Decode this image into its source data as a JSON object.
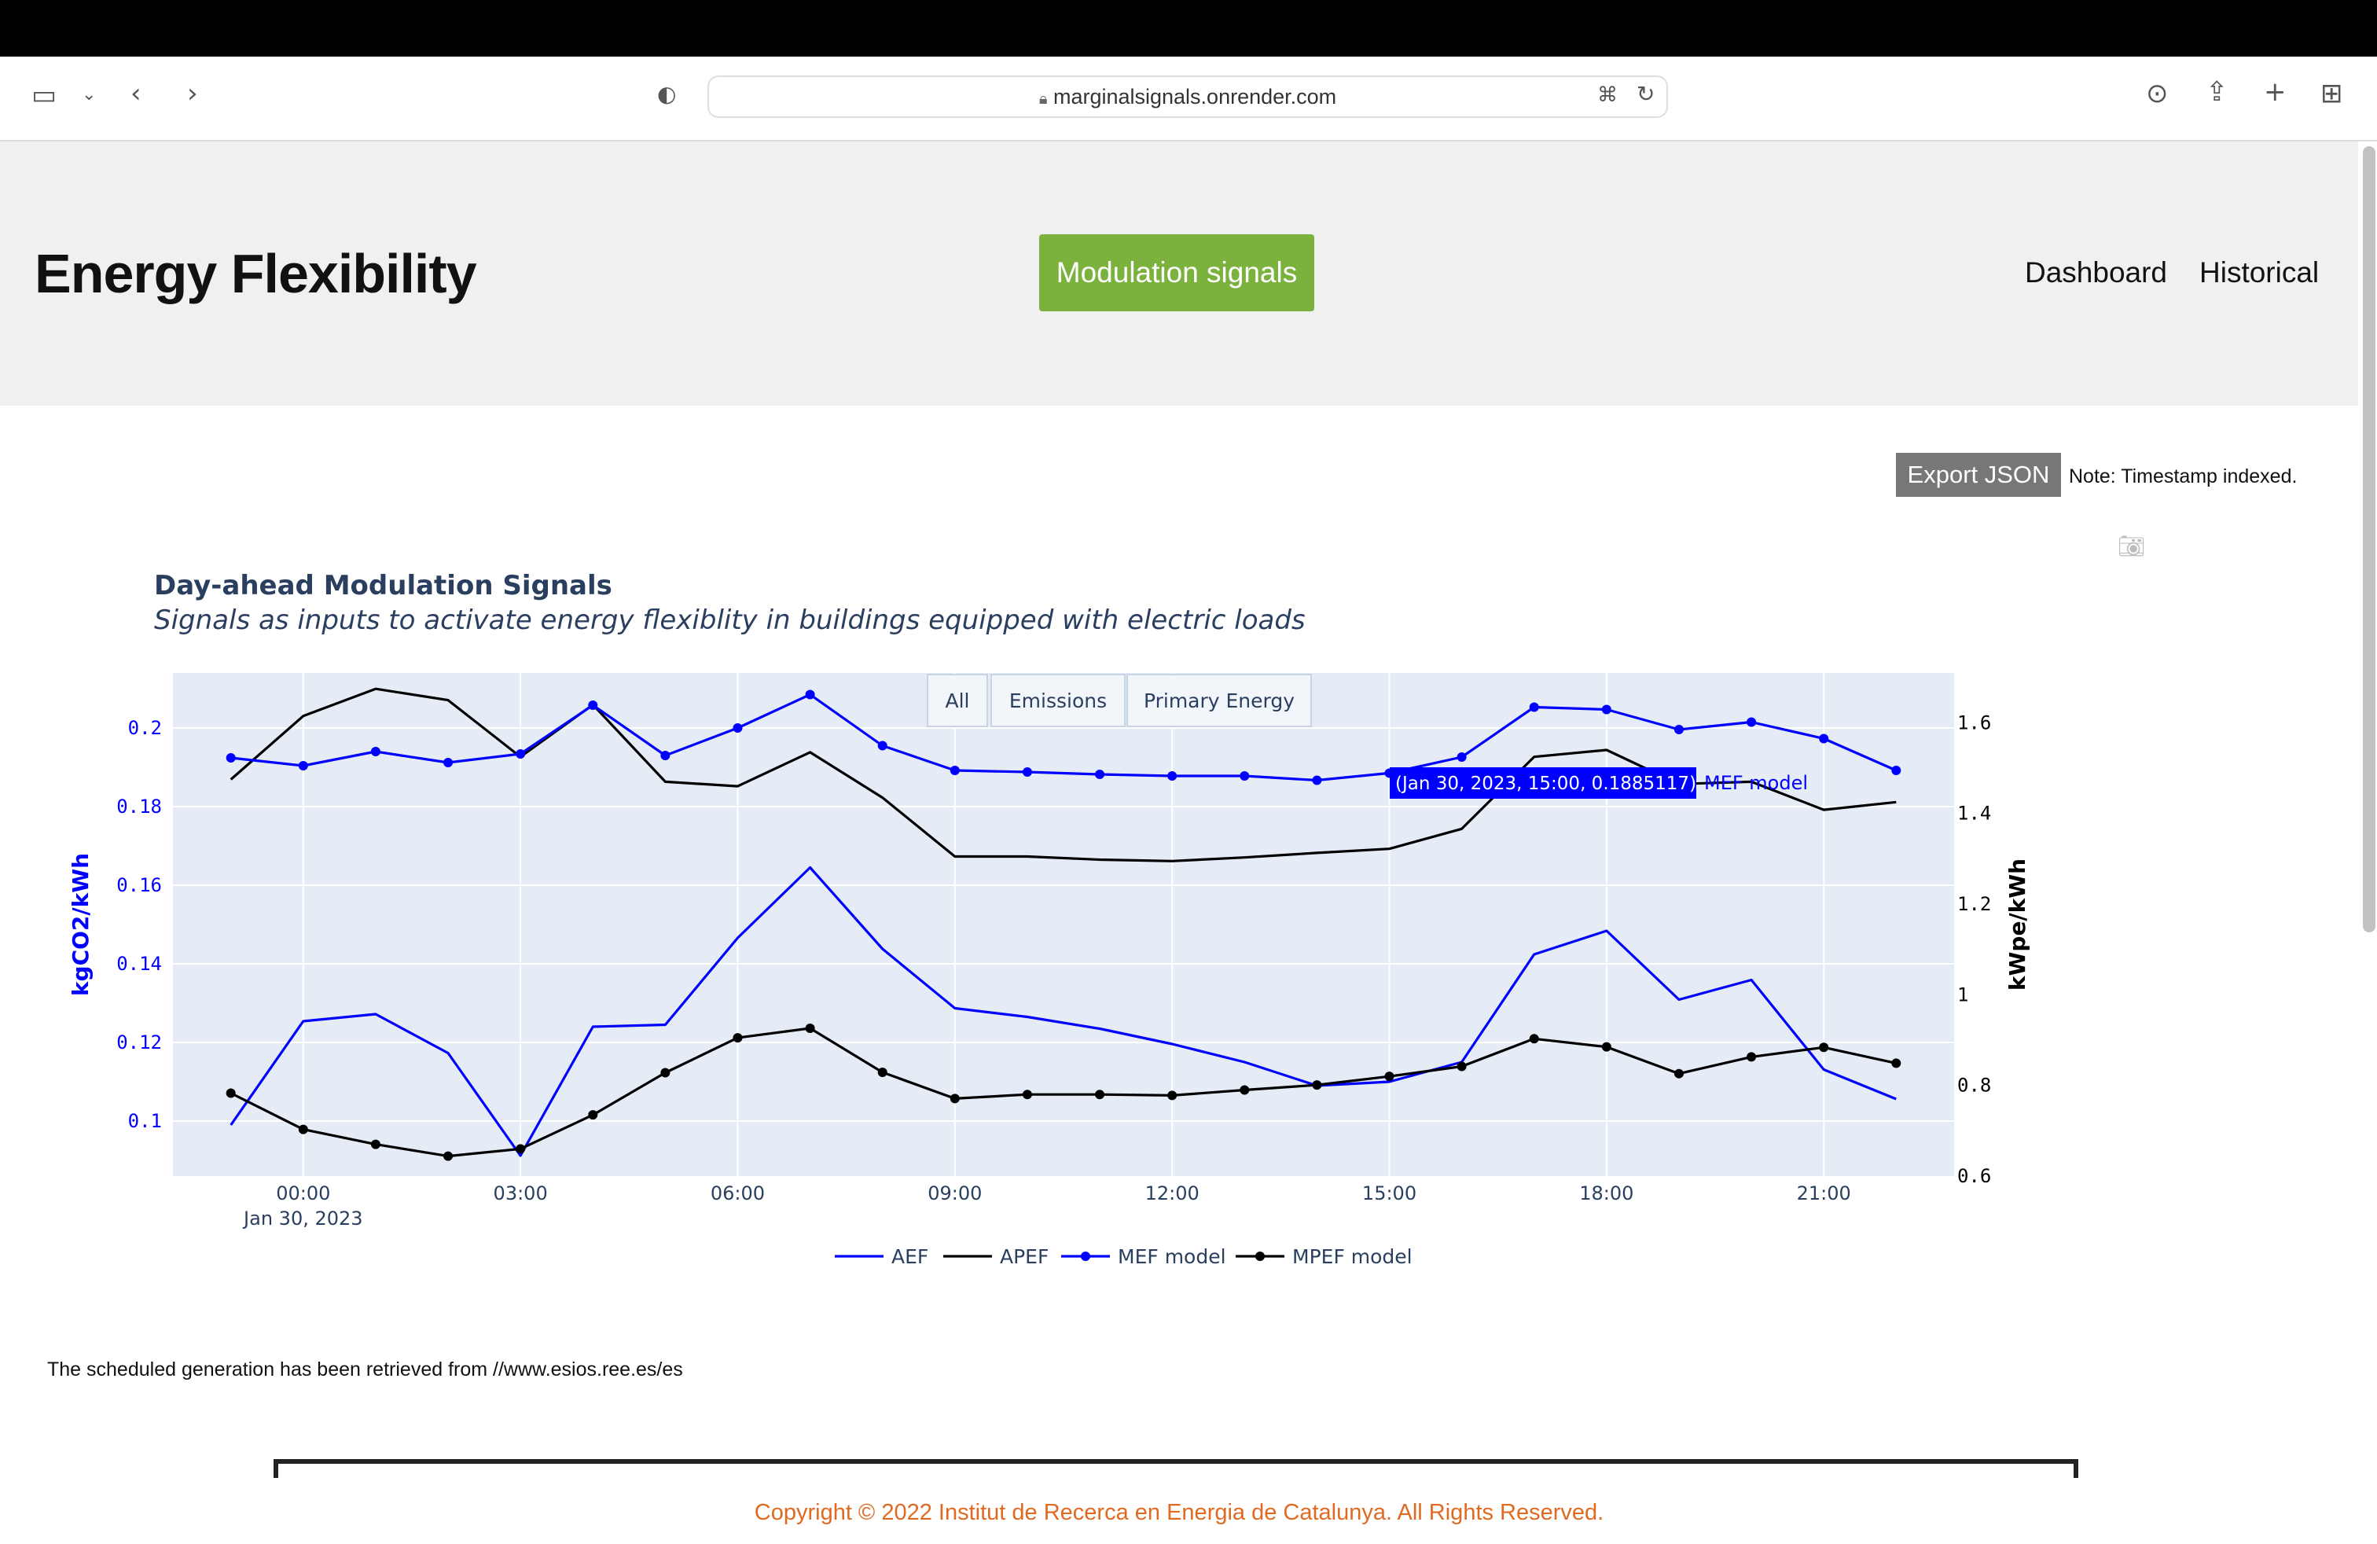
{
  "browser": {
    "url": "marginalsignals.onrender.com"
  },
  "header": {
    "brand": "Energy Flexibility",
    "active_nav": "Modulation signals",
    "nav_items": [
      "Dashboard",
      "Historical"
    ]
  },
  "export": {
    "button_label": "Export JSON",
    "note": "Note: Timestamp indexed."
  },
  "chart_data": {
    "type": "line",
    "title": "Day-ahead Modulation Signals",
    "subtitle": "Signals as inputs to activate energy flexiblity in buildings equipped with electric loads",
    "buttons": [
      "All",
      "Emissions",
      "Primary Energy"
    ],
    "ylabel_left": "kgCO2/kWh",
    "ylabel_right": "kWpe/kWh",
    "ylim_left": [
      0.086,
      0.214
    ],
    "ylim_right": [
      0.6,
      1.71
    ],
    "x": [
      -1,
      0,
      1,
      2,
      3,
      4,
      5,
      6,
      7,
      8,
      9,
      10,
      11,
      12,
      13,
      14,
      15,
      16,
      17,
      18,
      19,
      20,
      21,
      22
    ],
    "x_ticks": [
      {
        "value": 0,
        "label": "00:00",
        "sublabel": "Jan 30, 2023"
      },
      {
        "value": 3,
        "label": "03:00"
      },
      {
        "value": 6,
        "label": "06:00"
      },
      {
        "value": 9,
        "label": "09:00"
      },
      {
        "value": 12,
        "label": "12:00"
      },
      {
        "value": 15,
        "label": "15:00"
      },
      {
        "value": 18,
        "label": "18:00"
      },
      {
        "value": 21,
        "label": "21:00"
      }
    ],
    "y_ticks_left": [
      "0.1",
      "0.12",
      "0.14",
      "0.16",
      "0.18",
      "0.2"
    ],
    "y_ticks_left_values": [
      0.1,
      0.12,
      0.14,
      0.16,
      0.18,
      0.2
    ],
    "y_ticks_right": [
      "0.6",
      "0.8",
      "1",
      "1.2",
      "1.4",
      "1.6"
    ],
    "y_ticks_right_values": [
      0.6,
      0.8,
      1.0,
      1.2,
      1.4,
      1.6
    ],
    "series": [
      {
        "name": "AEF",
        "axis": "left",
        "color": "#0000ff",
        "markers": false,
        "values": [
          0.099,
          0.1254,
          0.1272,
          0.1173,
          0.0912,
          0.124,
          0.1245,
          0.1466,
          0.1645,
          0.1438,
          0.1287,
          0.1265,
          0.1235,
          0.1196,
          0.115,
          0.109,
          0.11,
          0.115,
          0.1424,
          0.1484,
          0.1309,
          0.1359,
          0.1131,
          0.1056
        ]
      },
      {
        "name": "APEF",
        "axis": "right",
        "color": "#000000",
        "markers": false,
        "values": [
          1.475,
          1.615,
          1.675,
          1.65,
          1.525,
          1.64,
          1.47,
          1.46,
          1.535,
          1.435,
          1.305,
          1.305,
          1.298,
          1.295,
          1.303,
          1.313,
          1.322,
          1.366,
          1.525,
          1.54,
          1.465,
          1.47,
          1.408,
          1.425
        ]
      },
      {
        "name": "MEF model",
        "axis": "left",
        "color": "#0000ff",
        "markers": true,
        "values": [
          0.1924,
          0.1904,
          0.194,
          0.1912,
          0.1934,
          0.2058,
          0.193,
          0.2,
          0.2085,
          0.1955,
          0.1892,
          0.1888,
          0.1882,
          0.1878,
          0.1878,
          0.1867,
          0.1885117,
          0.1926,
          0.2053,
          0.2047,
          0.1996,
          0.2015,
          0.1973,
          0.1892
        ]
      },
      {
        "name": "MPEF model",
        "axis": "right",
        "color": "#000000",
        "markers": true,
        "values": [
          0.783,
          0.703,
          0.67,
          0.644,
          0.66,
          0.735,
          0.828,
          0.905,
          0.926,
          0.829,
          0.771,
          0.78,
          0.78,
          0.778,
          0.79,
          0.801,
          0.82,
          0.842,
          0.903,
          0.885,
          0.826,
          0.863,
          0.884,
          0.849
        ]
      }
    ],
    "hover": {
      "text": "(Jan 30, 2023, 15:00, 0.1885117)",
      "series": "MEF model"
    },
    "legend_position": "bottom-center"
  },
  "footer": {
    "source": "The scheduled generation has been retrieved from //www.esios.ree.es/es",
    "copyright": "Copyright © 2022 Institut de Recerca en Energia de Catalunya. All Rights Reserved."
  }
}
